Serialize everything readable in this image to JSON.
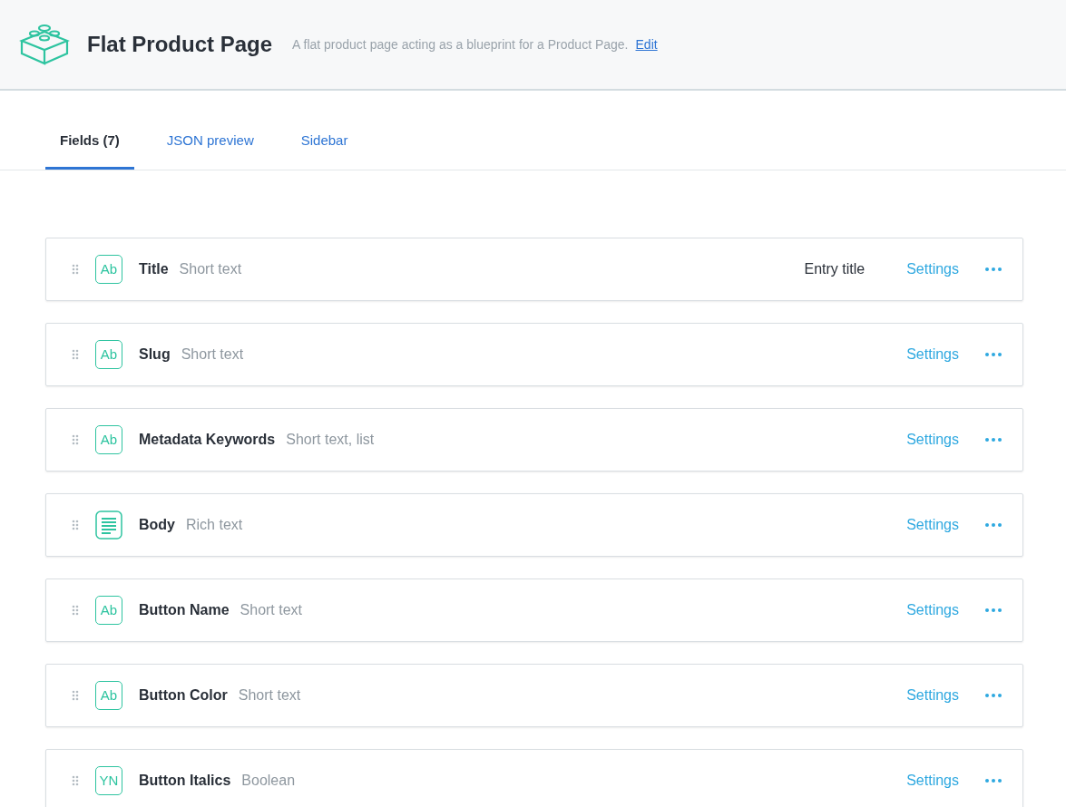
{
  "header": {
    "title": "Flat Product Page",
    "description": "A flat product page acting as a blueprint for a Product Page.",
    "edit_link": "Edit"
  },
  "tabs": [
    {
      "label": "Fields (7)",
      "selected": true
    },
    {
      "label": "JSON preview",
      "selected": false
    },
    {
      "label": "Sidebar",
      "selected": false
    }
  ],
  "fields": [
    {
      "kind": "text",
      "badge": "Ab",
      "name": "Title",
      "type": "Short text",
      "note": "Entry title",
      "settings": "Settings"
    },
    {
      "kind": "text",
      "badge": "Ab",
      "name": "Slug",
      "type": "Short text",
      "settings": "Settings"
    },
    {
      "kind": "text",
      "badge": "Ab",
      "name": "Metadata Keywords",
      "type": "Short text, list",
      "settings": "Settings"
    },
    {
      "kind": "richtext",
      "name": "Body",
      "type": "Rich text",
      "settings": "Settings"
    },
    {
      "kind": "text",
      "badge": "Ab",
      "name": "Button Name",
      "type": "Short text",
      "settings": "Settings"
    },
    {
      "kind": "text",
      "badge": "Ab",
      "name": "Button Color",
      "type": "Short text",
      "settings": "Settings"
    },
    {
      "kind": "boolean",
      "badge": "YN",
      "name": "Button Italics",
      "type": "Boolean",
      "settings": "Settings"
    }
  ]
}
